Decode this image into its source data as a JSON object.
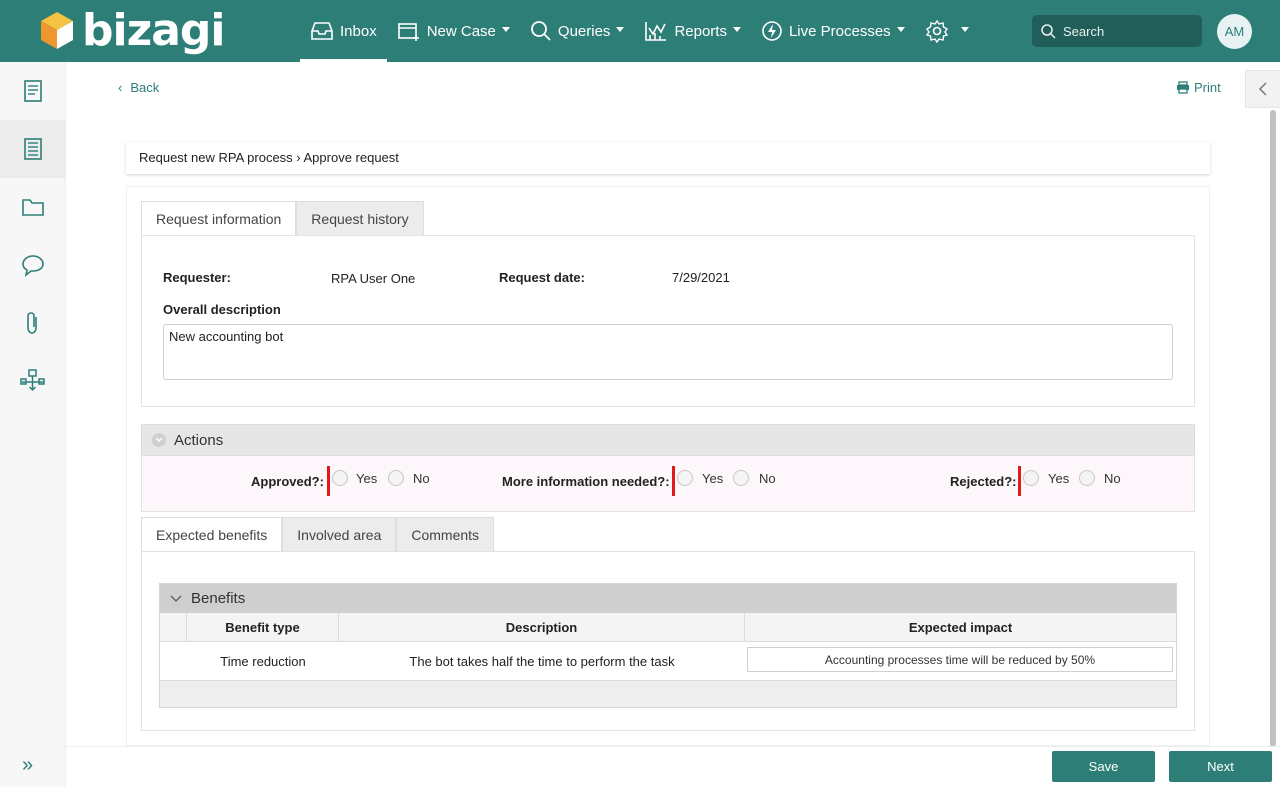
{
  "brand": {
    "name": "bizagi",
    "color": "#2e7e78"
  },
  "nav": {
    "inbox": "Inbox",
    "new_case": "New Case",
    "queries": "Queries",
    "reports": "Reports",
    "live_processes": "Live Processes",
    "search_placeholder": "Search",
    "avatar_initials": "AM"
  },
  "page": {
    "back": "Back",
    "print": "Print",
    "breadcrumb": "Request new RPA process › Approve request"
  },
  "tabs_top": [
    "Request information",
    "Request history"
  ],
  "request": {
    "requester_label": "Requester:",
    "requester_value": "RPA User One",
    "date_label": "Request date:",
    "date_value": "7/29/2021",
    "description_label": "Overall description",
    "description_value": "New accounting bot"
  },
  "actions": {
    "title": "Actions",
    "approved_label": "Approved?:",
    "more_info_label": "More information needed?:",
    "rejected_label": "Rejected?:",
    "yes": "Yes",
    "no": "No"
  },
  "tabs_bottom": [
    "Expected benefits",
    "Involved area",
    "Comments"
  ],
  "benefits": {
    "title": "Benefits",
    "columns": [
      "Benefit type",
      "Description",
      "Expected impact"
    ],
    "rows": [
      {
        "type": "Time reduction",
        "description": "The bot takes half the time to perform the task",
        "impact": "Accounting processes time will be reduced by 50%"
      }
    ]
  },
  "buttons": {
    "save": "Save",
    "next": "Next"
  }
}
